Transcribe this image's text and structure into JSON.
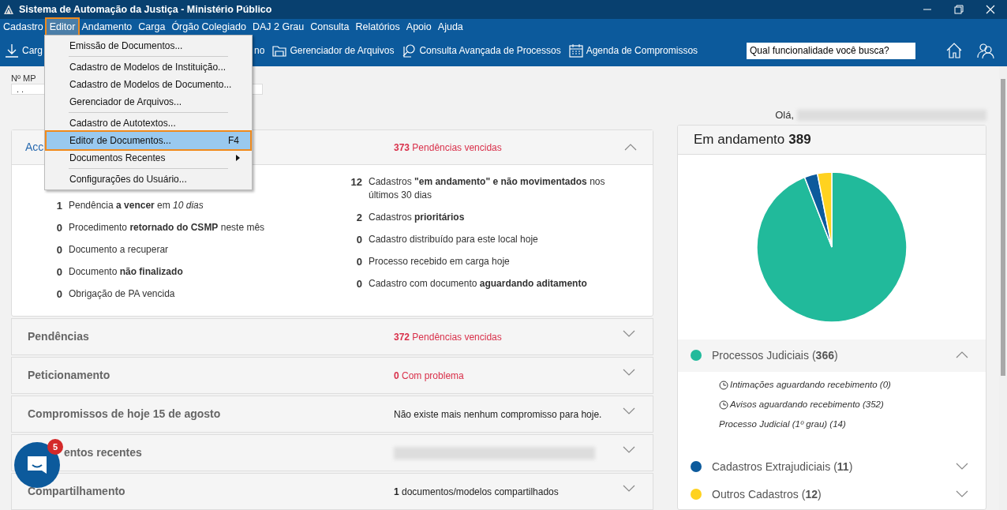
{
  "window": {
    "title": "Sistema de Automação da Justiça - Ministério Público"
  },
  "menubar": [
    {
      "label": "Cadastro",
      "selected": false
    },
    {
      "label": "Editor",
      "selected": true
    },
    {
      "label": "Andamento",
      "selected": false
    },
    {
      "label": "Carga",
      "selected": false
    },
    {
      "label": "Órgão Colegiado",
      "selected": false
    },
    {
      "label": "DAJ 2 Grau",
      "selected": false
    },
    {
      "label": "Consulta",
      "selected": false
    },
    {
      "label": "Relatórios",
      "selected": false
    },
    {
      "label": "Apoio",
      "selected": false
    },
    {
      "label": "Ajuda",
      "selected": false
    }
  ],
  "toolbar": [
    {
      "label": "Carg",
      "kind": "download"
    },
    {
      "label": "no",
      "kind": "none"
    },
    {
      "label": "Gerenciador de Arquivos",
      "kind": "folder"
    },
    {
      "label": "Consulta Avançada de Processos",
      "kind": "search"
    },
    {
      "label": "Agenda de Compromissos",
      "kind": "calendar"
    }
  ],
  "search": {
    "value": "Qual funcionalidade você busca?"
  },
  "mp_field": {
    "label": "Nº MP",
    "value": ". ."
  },
  "greeting": "Olá,",
  "editor_menu": [
    {
      "label": "Emissão de Documentos...",
      "kind": "item",
      "selected": false
    },
    {
      "kind": "separator"
    },
    {
      "label": "Cadastro de Modelos de Instituição...",
      "kind": "item",
      "selected": false
    },
    {
      "label": "Cadastro de Modelos de Documento...",
      "kind": "item",
      "selected": false
    },
    {
      "label": "Gerenciador de Arquivos...",
      "kind": "item",
      "selected": false
    },
    {
      "kind": "separator"
    },
    {
      "label": "Cadastro de Autotextos...",
      "kind": "item",
      "selected": false
    },
    {
      "label": "Editor de Documentos...",
      "kind": "item",
      "shortcut": "F4",
      "selected": true
    },
    {
      "label": "Documentos Recentes",
      "kind": "submenu",
      "selected": false
    },
    {
      "kind": "separator"
    },
    {
      "label": "Configurações do Usuário...",
      "kind": "item",
      "selected": false
    }
  ],
  "main_card": {
    "title": "Acc",
    "summary": "**373** Pendências vencidas",
    "expanded": true,
    "left_items": [
      {
        "count": "1",
        "text": "Pendência **a vencer** em *10 dias*"
      },
      {
        "count": "0",
        "text": "Procedimento **retornado do CSMP** neste mês"
      },
      {
        "count": "0",
        "text": "Documento a recuperar"
      },
      {
        "count": "0",
        "text": "Documento **não finalizado**"
      },
      {
        "count": "0",
        "text": "Obrigação de PA vencida"
      }
    ],
    "right_items": [
      {
        "count": "12",
        "text": "Cadastros **\"em andamento\" e não movimentados** nos últimos 30 dias"
      },
      {
        "count": "2",
        "text": "Cadastros **prioritários**"
      },
      {
        "count": "0",
        "text": "Cadastro distribuído para este local hoje"
      },
      {
        "count": "0",
        "text": "Processo recebido em carga hoje"
      },
      {
        "count": "0",
        "text": "Cadastro com documento **aguardando aditamento**"
      }
    ]
  },
  "sections": [
    {
      "title": "Pendências",
      "kind": "alert",
      "summary": "**372** Pendências vencidas",
      "expanded": false
    },
    {
      "title": "Peticionamento",
      "kind": "alert",
      "summary": "**0** Com problema",
      "expanded": false
    },
    {
      "title": "Compromissos de hoje 15 de agosto",
      "kind": "text",
      "summary": "Não existe mais nenhum compromisso para hoje.",
      "expanded": false
    },
    {
      "title": "entos recentes",
      "kind": "redacted",
      "expanded": false
    },
    {
      "title": "Compartilhamento",
      "kind": "text",
      "summary": "**1** documentos/modelos compartilhados",
      "expanded": false
    }
  ],
  "chat": {
    "badge": "5"
  },
  "progress_card": {
    "total": "389",
    "chart_data": {
      "type": "pie",
      "title": "Em andamento",
      "categories": [
        "Processos Judiciais",
        "Cadastros Extrajudiciais",
        "Outros Cadastros"
      ],
      "series": [
        {
          "values": [
            94.09,
            2.83,
            3.08
          ]
        }
      ]
    },
    "legend": [
      {
        "count": "(**366**)",
        "color": "#21ba9b",
        "expanded": true,
        "children": [
          {
            "text": "Intimações aguardando recebimento (0)",
            "kind": "clock"
          },
          {
            "text": "Avisos aguardando recebimento (352)",
            "kind": "clock"
          },
          {
            "text": "Processo Judicial (1º grau) (14)",
            "kind": "plain"
          }
        ]
      },
      {
        "count": "(**11**)",
        "color": "#0c5a9c",
        "expanded": false
      },
      {
        "count": "(**12**)",
        "color": "#ffd21f",
        "expanded": false
      }
    ]
  }
}
